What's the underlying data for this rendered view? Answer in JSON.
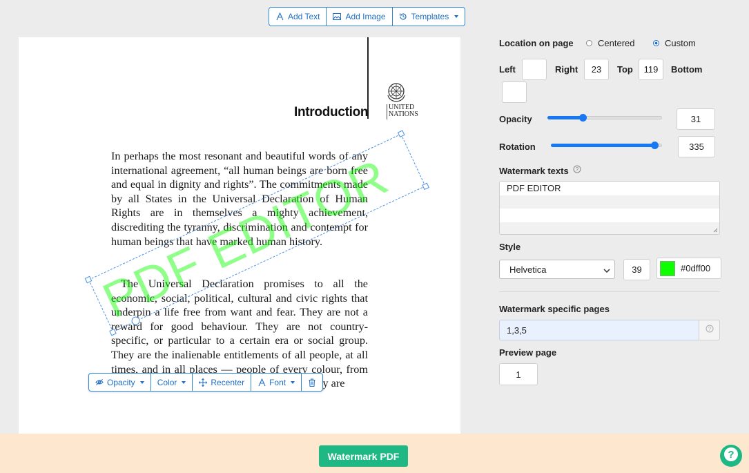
{
  "toolbar": {
    "add_text": "Add Text",
    "add_image": "Add Image",
    "templates": "Templates"
  },
  "document": {
    "title": "Introduction",
    "logo_text_line1": "UNITED",
    "logo_text_line2": "NATIONS",
    "paragraph1": "In perhaps the most resonant and beautiful words of any international agreement, “all human beings are born free and equal in dignity and rights”. The commitments made by all States in the Universal Declaration of Human Rights are in themselves a mighty achievement, discrediting the tyranny, discrimination and contempt for human beings that have marked human history.",
    "paragraph2": "The Universal Declaration promises to all the economic, social, political, cultural and civic rights that underpin a life free from want and fear. They are not a reward for good behaviour. They are not country-specific, or particular to a certain era or social group. They are the inalienable entitlements of all people, at all times, and in all places — people of every colour, from every race and ethnic group; whether or not they are"
  },
  "watermark": {
    "text": "PDF EDITOR",
    "color": "#0dff00"
  },
  "float_toolbar": {
    "opacity": "Opacity",
    "color": "Color",
    "recenter": "Recenter",
    "font": "Font"
  },
  "panel": {
    "location_label": "Location on page",
    "centered_label": "Centered",
    "custom_label": "Custom",
    "selected_location": "Custom",
    "left_label": "Left",
    "left_value": "",
    "right_label": "Right",
    "right_value": "23",
    "top_label": "Top",
    "top_value": "119",
    "bottom_label": "Bottom",
    "bottom_value": "",
    "opacity_label": "Opacity",
    "opacity_value": "31",
    "opacity_fraction": 0.31,
    "rotation_label": "Rotation",
    "rotation_value": "335",
    "rotation_fraction": 0.93,
    "texts_label": "Watermark texts",
    "texts_lines": [
      "PDF EDITOR",
      "",
      "",
      ""
    ],
    "style_label": "Style",
    "font_select": "Helvetica",
    "font_size": "39",
    "color_hex": "#0dff00",
    "pages_label": "Watermark specific pages",
    "pages_value": "1,3,5",
    "preview_label": "Preview page",
    "preview_value": "1"
  },
  "footer": {
    "watermark_button": "Watermark PDF"
  },
  "colors": {
    "accent": "#1f6fc4",
    "primary_button": "#1fb885",
    "slider": "#1877f2"
  }
}
